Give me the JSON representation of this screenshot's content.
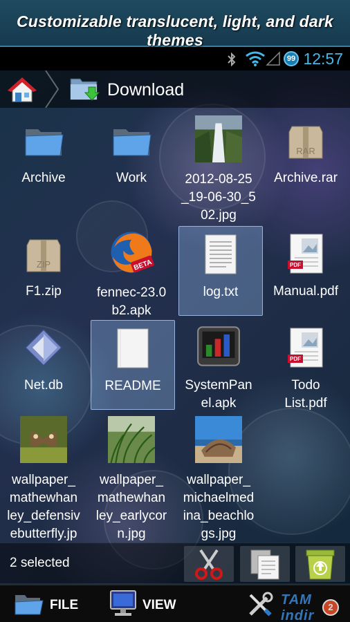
{
  "banner": {
    "text": "Customizable translucent, light, and dark themes"
  },
  "status_bar": {
    "time": "12:57",
    "notification_count": "99"
  },
  "path_bar": {
    "folder": "Download"
  },
  "files": [
    {
      "name": "Archive",
      "kind": "folder"
    },
    {
      "name": "Work",
      "kind": "folder"
    },
    {
      "name": "2012-08-25_19-06-30_502.jpg",
      "display": "2012-08-25\n_19-06-30_5\n02.jpg",
      "kind": "image-waterfall"
    },
    {
      "name": "Archive.rar",
      "kind": "archive",
      "badge": "RAR"
    },
    {
      "name": "F1.zip",
      "kind": "archive",
      "badge": "ZIP"
    },
    {
      "name": "fennec-23.0b2.apk",
      "display": "fennec-23.0\nb2.apk",
      "kind": "firefox",
      "badge": "BETA"
    },
    {
      "name": "log.txt",
      "kind": "text",
      "selected": true
    },
    {
      "name": "Manual.pdf",
      "kind": "pdf",
      "badge": "PDF"
    },
    {
      "name": "Net.db",
      "kind": "db"
    },
    {
      "name": "README",
      "kind": "blank",
      "selected": true
    },
    {
      "name": "SystemPanel.apk",
      "display": "SystemPan\nel.apk",
      "kind": "systempanel"
    },
    {
      "name": "Todo List.pdf",
      "display": "Todo\nList.pdf",
      "kind": "pdf",
      "badge": "PDF"
    },
    {
      "name": "wallpaper_mathewhanley_defensivebutterfly.jpg",
      "display": "wallpaper_\nmathewhan\nley_defensiv\nebutterfly.jp",
      "kind": "image-butterfly"
    },
    {
      "name": "wallpaper_mathewhanley_earlycorn.jpg",
      "display": "wallpaper_\nmathewhan\nley_earlycor\nn.jpg",
      "kind": "image-grass"
    },
    {
      "name": "wallpaper_michaelmedina_beachlogs.jpg",
      "display": "wallpaper_\nmichaelmed\nina_beachlo\ngs.jpg",
      "kind": "image-beach"
    }
  ],
  "action_bar": {
    "selection_text": "2 selected"
  },
  "bottom_bar": {
    "file_label": "FILE",
    "view_label": "VIEW"
  },
  "watermark": {
    "text": "TAM indir"
  },
  "colors": {
    "accent": "#44b8e8",
    "selection": "#96bef0"
  }
}
